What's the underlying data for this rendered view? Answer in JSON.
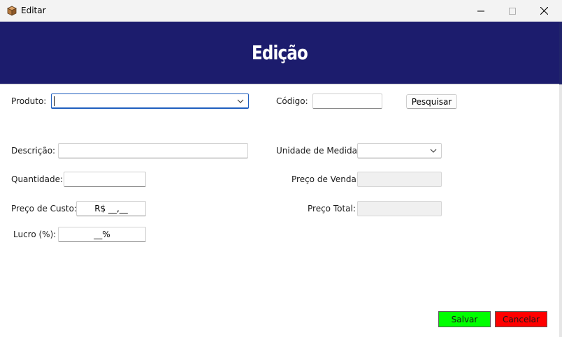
{
  "window": {
    "title": "Editar",
    "icon": "box-icon"
  },
  "header": {
    "title": "Edição",
    "background_color": "#1c1c6d"
  },
  "form": {
    "produto": {
      "label": "Produto:",
      "value": ""
    },
    "codigo": {
      "label": "Código:",
      "value": ""
    },
    "pesquisar_label": "Pesquisar",
    "descricao": {
      "label": "Descrição:",
      "value": ""
    },
    "unidade_medida": {
      "label": "Unidade de Medida:",
      "value": ""
    },
    "quantidade": {
      "label": "Quantidade:",
      "value": ""
    },
    "preco_venda": {
      "label": "Preço de Venda:",
      "value": ""
    },
    "preco_custo": {
      "label": "Preço de Custo:",
      "value": "R$ __,__"
    },
    "preco_total": {
      "label": "Preço Total:",
      "value": ""
    },
    "lucro": {
      "label": "Lucro (%):",
      "value": "__%"
    }
  },
  "actions": {
    "save_label": "Salvar",
    "save_color": "#00ff00",
    "cancel_label": "Cancelar",
    "cancel_color": "#ff0000"
  }
}
